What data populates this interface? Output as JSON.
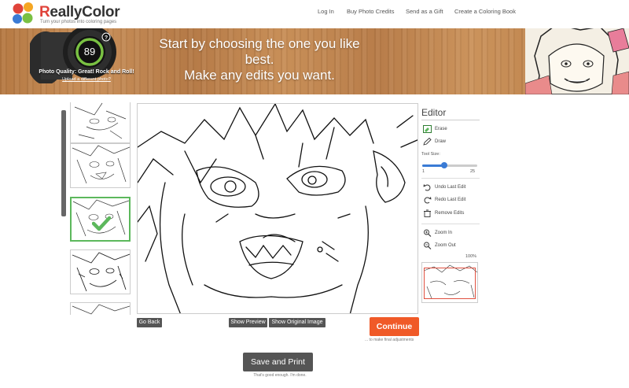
{
  "header": {
    "logo_text": "ReallyColor",
    "tagline": "Turn your photos into coloring pages",
    "nav": [
      "Log In",
      "Buy Photo Credits",
      "Send as a Gift",
      "Create a Coloring Book"
    ]
  },
  "banner": {
    "headline_1": "Start by choosing the one you like",
    "headline_2": "best.",
    "headline_3": "Make any edits you want.",
    "quality_score": "89",
    "quality_text": "Photo Quality: Great! Rock and Roll!",
    "upload_link": "Upload a different photo?"
  },
  "editor": {
    "title": "Editor",
    "tools": {
      "erase": "Erase",
      "draw": "Draw",
      "tool_size_label": "Tool Size:",
      "size_min": "1",
      "size_max": "25",
      "size_value": 9,
      "undo": "Undo Last Edit",
      "redo": "Redo Last Edit",
      "remove": "Remove Edits",
      "zoom_in": "Zoom In",
      "zoom_out": "Zoom Out",
      "zoom_level": "100%"
    }
  },
  "buttons": {
    "go_back": "Go Back",
    "show_preview": "Show Preview",
    "show_original": "Show Original Image",
    "continue": "Continue",
    "continue_sub": "... to make final adjustments",
    "save_print": "Save and Print",
    "save_sub": "That's good enough. I'm done."
  },
  "colors": {
    "accent_orange": "#f05a28",
    "selected_green": "#5cb85c",
    "dark_button": "#555555"
  }
}
